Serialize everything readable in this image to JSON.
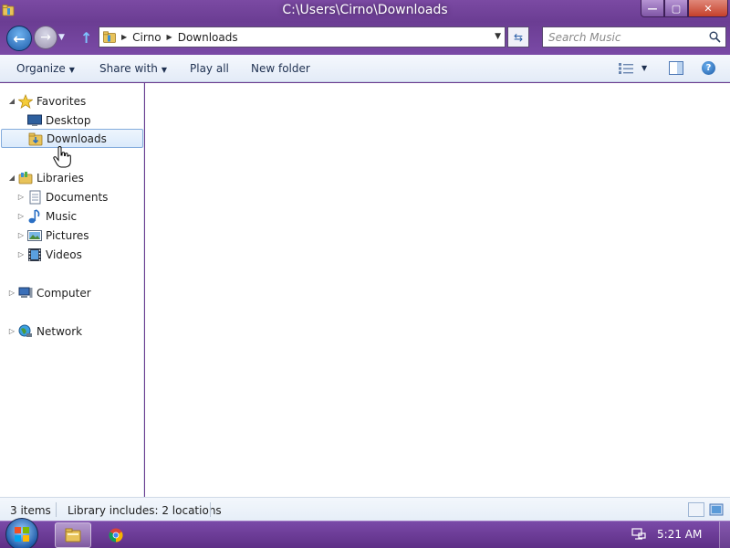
{
  "window": {
    "title": "C:\\Users\\Cirno\\Downloads",
    "controls": {
      "minimize": "—",
      "maximize": "▢",
      "close": "✕"
    }
  },
  "navigation": {
    "breadcrumb": [
      "Cirno",
      "Downloads"
    ],
    "search_placeholder": "Search Music"
  },
  "commands": {
    "organize": "Organize",
    "share_with": "Share with",
    "play_all": "Play all",
    "new_folder": "New folder"
  },
  "tree": {
    "favorites": {
      "label": "Favorites",
      "items": [
        {
          "label": "Desktop"
        },
        {
          "label": "Downloads",
          "selected": true
        }
      ]
    },
    "libraries": {
      "label": "Libraries",
      "items": [
        {
          "label": "Documents"
        },
        {
          "label": "Music"
        },
        {
          "label": "Pictures"
        },
        {
          "label": "Videos"
        }
      ]
    },
    "computer": {
      "label": "Computer"
    },
    "network": {
      "label": "Network"
    }
  },
  "status": {
    "item_count": "3 items",
    "library_info": "Library includes: 2 locations"
  },
  "taskbar": {
    "clock": "5:21 AM",
    "pinned": [
      "explorer-icon",
      "chrome-icon"
    ]
  },
  "colors": {
    "aero_purple": "#6b3d93",
    "selection_border": "#84acdd",
    "command_bar": "#e3ebf7"
  }
}
